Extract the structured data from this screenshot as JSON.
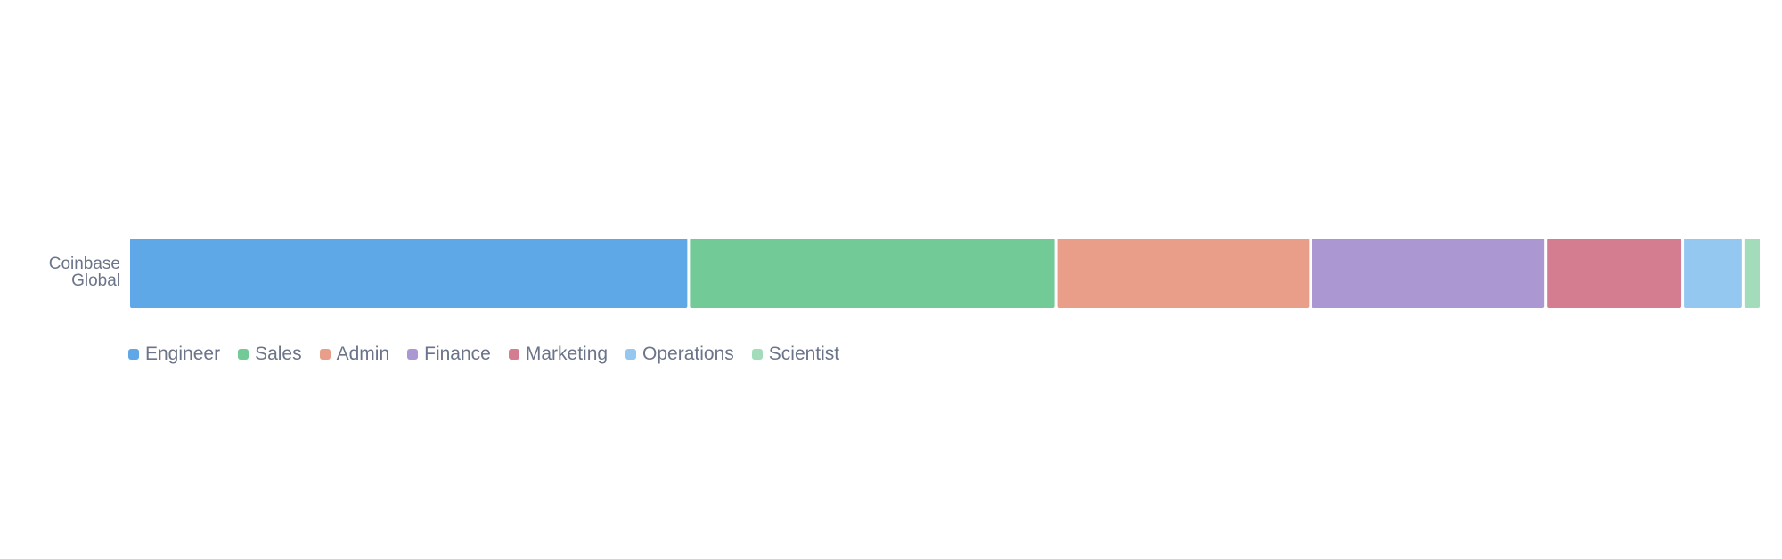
{
  "chart_data": {
    "type": "bar",
    "orientation": "horizontal",
    "stacked": true,
    "normalized": true,
    "title": "",
    "xlabel": "",
    "ylabel": "",
    "categories": [
      "Coinbase Global"
    ],
    "category_lines": [
      "Coinbase",
      "Global"
    ],
    "xlim": [
      0,
      100
    ],
    "grid": false,
    "legend_position": "bottom-left",
    "series": [
      {
        "name": "Engineer",
        "color": "#5fa8e8",
        "values": [
          34.3
        ]
      },
      {
        "name": "Sales",
        "color": "#72ca97",
        "values": [
          22.5
        ]
      },
      {
        "name": "Admin",
        "color": "#e89e89",
        "values": [
          15.6
        ]
      },
      {
        "name": "Finance",
        "color": "#ab98d3",
        "values": [
          14.4
        ]
      },
      {
        "name": "Marketing",
        "color": "#d47d91",
        "values": [
          8.4
        ]
      },
      {
        "name": "Operations",
        "color": "#95c8f0",
        "values": [
          3.7
        ]
      },
      {
        "name": "Scientist",
        "color": "#a2dcbb",
        "values": [
          1.1
        ]
      }
    ]
  }
}
